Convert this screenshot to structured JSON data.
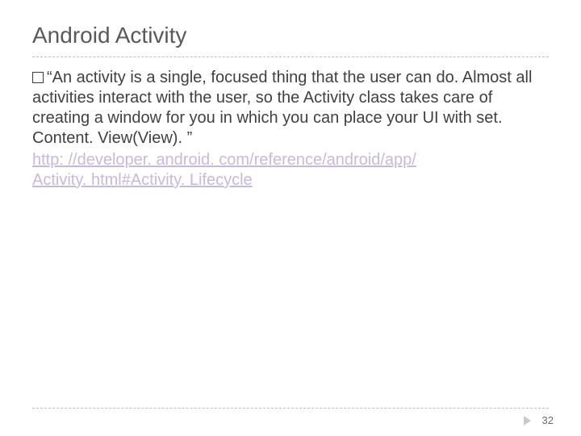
{
  "slide": {
    "title": "Android Activity",
    "bullet_text": "“An activity is a single, focused thing that the user can do. Almost all activities interact with the user, so the Activity class takes care of creating a window for you in which you can place your UI with set. Content. View(View). ”",
    "link_text_line1": "http: //developer. android. com/reference/android/app/",
    "link_text_line2": "Activity. html#Activity. Lifecycle",
    "page_number": "32"
  }
}
